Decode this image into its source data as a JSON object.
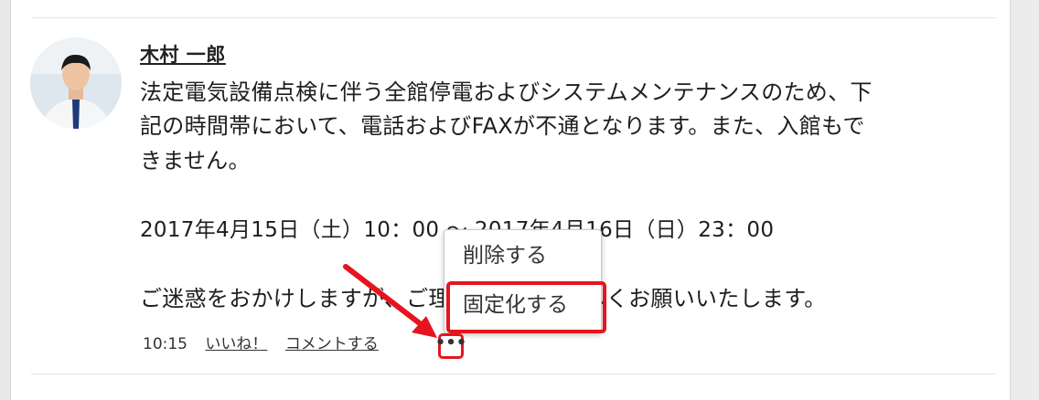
{
  "post": {
    "author": "木村 一郎",
    "lines": [
      "法定電気設備点検に伴う全館停電およびシステムメンテナンスのため、下",
      "記の時間帯において、電話およびFAXが不通となります。また、入館もで",
      "きません。",
      "2017年4月15日（土）10：00 ～ 2017年4月16日（日）23：00",
      "ご迷惑をおかけしますが、ご理解のほどよろしくお願いいたします。"
    ],
    "time": "10:15",
    "like_label": "いいね！",
    "comment_label": "コメントする",
    "more_icon": "more-horizontal-icon"
  },
  "menu": {
    "items": [
      {
        "label": "削除する"
      },
      {
        "label": "固定化する"
      }
    ]
  },
  "colors": {
    "highlight": "#e4151f"
  }
}
